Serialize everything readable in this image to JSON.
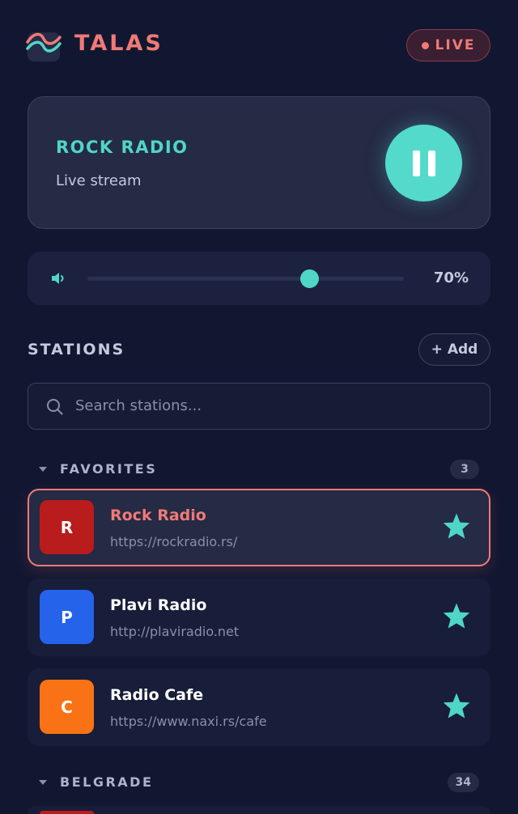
{
  "app": {
    "brand": "TALAS",
    "live_label": "LIVE"
  },
  "now_playing": {
    "title": "ROCK RADIO",
    "subtitle": "Live stream",
    "state": "playing"
  },
  "volume": {
    "level": 0.7,
    "label": "70%"
  },
  "stations": {
    "title": "STATIONS",
    "add_label": "+ Add",
    "search": {
      "placeholder": "Search stations...",
      "value": ""
    },
    "groups": [
      {
        "label": "FAVORITES",
        "count": "3",
        "items": [
          {
            "initial": "R",
            "name": "Rock Radio",
            "url": "https://rockradio.rs/",
            "color": "#b91c1c",
            "favorite": true,
            "active": true
          },
          {
            "initial": "P",
            "name": "Plavi Radio",
            "url": "http://plaviradio.net",
            "color": "#2563eb",
            "favorite": true,
            "active": false
          },
          {
            "initial": "C",
            "name": "Radio Cafe",
            "url": "https://www.naxi.rs/cafe",
            "color": "#f97316",
            "favorite": true,
            "active": false
          }
        ]
      },
      {
        "label": "BELGRADE",
        "count": "34",
        "items": []
      }
    ]
  },
  "colors": {
    "accent": "#4fd6c7",
    "brand": "#f07a76",
    "background": "#121731"
  },
  "icons": [
    "wave-logo-icon",
    "live-dot-icon",
    "pause-icon",
    "volume-icon",
    "search-icon",
    "caret-down-icon",
    "star-icon"
  ]
}
